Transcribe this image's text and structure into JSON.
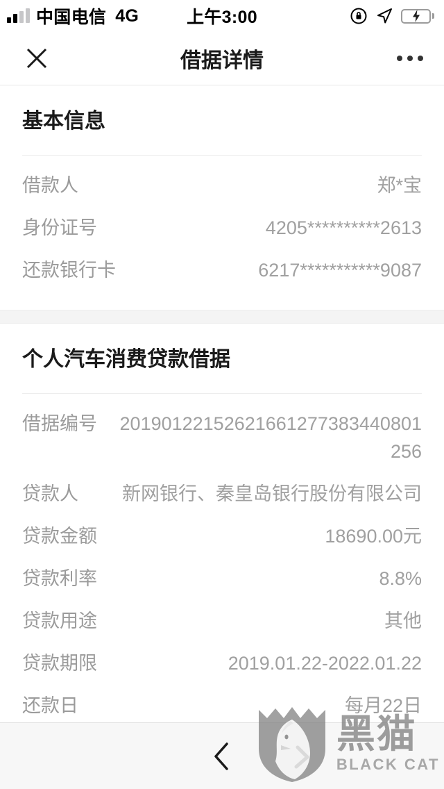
{
  "status_bar": {
    "carrier": "中国电信",
    "network": "4G",
    "time": "上午3:00",
    "signal_icon": "signal-bars-icon",
    "rotation_lock_icon": "rotation-lock-icon",
    "location_icon": "location-arrow-icon",
    "battery_icon": "battery-charging-icon",
    "battery_color": "#4cd964"
  },
  "nav": {
    "close_icon": "close-icon",
    "title": "借据详情",
    "more_icon": "more-options-icon"
  },
  "sections": [
    {
      "title": "基本信息",
      "rows": [
        {
          "label": "借款人",
          "value": "郑*宝"
        },
        {
          "label": "身份证号",
          "value": "4205**********2613"
        },
        {
          "label": "还款银行卡",
          "value": "6217***********9087"
        }
      ]
    },
    {
      "title": "个人汽车消费贷款借据",
      "rows": [
        {
          "label": "借据编号",
          "value": "20190122152621661277383440801256"
        },
        {
          "label": "贷款人",
          "value": "新网银行、秦皇岛银行股份有限公司"
        },
        {
          "label": "贷款金额",
          "value": "18690.00元"
        },
        {
          "label": "贷款利率",
          "value": "8.8%"
        },
        {
          "label": "贷款用途",
          "value": "其他"
        },
        {
          "label": "贷款期限",
          "value": "2019.01.22-2022.01.22"
        },
        {
          "label": "还款日",
          "value": "每月22日"
        }
      ]
    }
  ],
  "bottom_bar": {
    "back_icon": "back-chevron-icon"
  },
  "watermark": {
    "logo_icon": "black-cat-shield-logo",
    "cn_text": "黑猫",
    "en_text": "BLACK CAT"
  }
}
